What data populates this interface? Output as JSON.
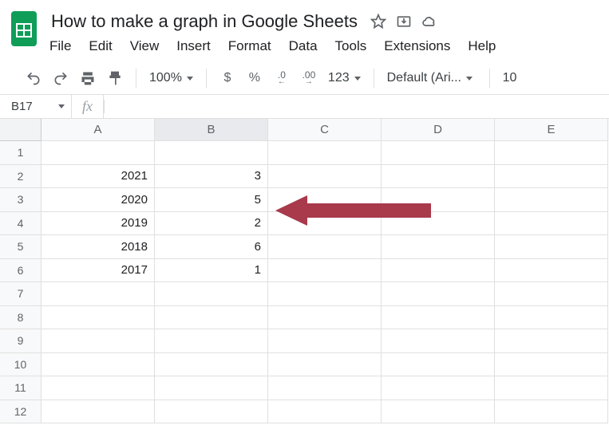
{
  "doc_title": "How to make a graph in Google Sheets",
  "menubar": {
    "file": "File",
    "edit": "Edit",
    "view": "View",
    "insert": "Insert",
    "format": "Format",
    "data": "Data",
    "tools": "Tools",
    "extensions": "Extensions",
    "help": "Help"
  },
  "toolbar": {
    "zoom": "100%",
    "currency": "$",
    "percent": "%",
    "dec_dec": ".0",
    "inc_dec": ".00",
    "more_fmt": "123",
    "font": "Default (Ari...",
    "font_size": "10"
  },
  "namebox": "B17",
  "columns": [
    "A",
    "B",
    "C",
    "D",
    "E"
  ],
  "selected_col": "B",
  "rows_visible": [
    "1",
    "2",
    "3",
    "4",
    "5",
    "6",
    "7",
    "8",
    "9",
    "10",
    "11",
    "12"
  ],
  "cells": {
    "r2": {
      "A": "2021",
      "B": "3"
    },
    "r3": {
      "A": "2020",
      "B": "5"
    },
    "r4": {
      "A": "2019",
      "B": "2"
    },
    "r5": {
      "A": "2018",
      "B": "6"
    },
    "r6": {
      "A": "2017",
      "B": "1"
    }
  },
  "annotation": {
    "arrow_color": "#a83a4b"
  }
}
